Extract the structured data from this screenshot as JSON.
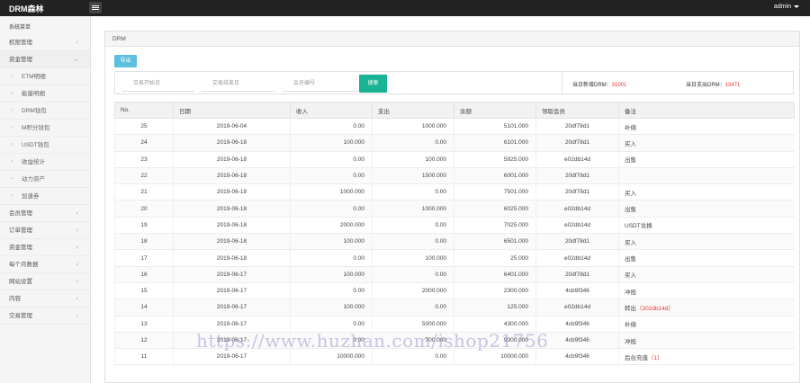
{
  "topbar": {
    "brand": "DRM森林",
    "user": "admin"
  },
  "sidebar": {
    "heading": "系统菜单",
    "items": [
      {
        "label": "权限管理",
        "chevron": "‹",
        "sub": false
      },
      {
        "label": "资金管理",
        "chevron": "⌄",
        "sub": false,
        "open": true
      },
      {
        "label": "ETM明细",
        "sub": true
      },
      {
        "label": "能量明细",
        "sub": true
      },
      {
        "label": "DRM钱包",
        "sub": true
      },
      {
        "label": "M积分钱包",
        "sub": true
      },
      {
        "label": "USDT钱包",
        "sub": true
      },
      {
        "label": "收益统计",
        "sub": true
      },
      {
        "label": "动力资产",
        "sub": true
      },
      {
        "label": "加速券",
        "sub": true
      },
      {
        "label": "会员管理",
        "chevron": "‹",
        "sub": false
      },
      {
        "label": "订单管理",
        "chevron": "‹",
        "sub": false
      },
      {
        "label": "资金管理",
        "chevron": "‹",
        "sub": false
      },
      {
        "label": "每个月数据",
        "chevron": "‹",
        "sub": false
      },
      {
        "label": "网站设置",
        "chevron": "‹",
        "sub": false
      },
      {
        "label": "内容",
        "chevron": "‹",
        "sub": false
      },
      {
        "label": "交易管理",
        "chevron": "‹",
        "sub": false
      }
    ]
  },
  "panel": {
    "title": "DRM",
    "export_label": "导出"
  },
  "filters": {
    "start_placeholder": "交易开始日",
    "end_placeholder": "交易结束日",
    "member_placeholder": "会员编号",
    "search_label": "搜索"
  },
  "stats": {
    "new_label": "当日新增DRM：",
    "new_value": "31001",
    "out_label": "当日支出DRM：",
    "out_value": "13471"
  },
  "table": {
    "headers": [
      "No.",
      "日期",
      "收入",
      "支出",
      "余额",
      "领取会员",
      "备注"
    ],
    "rows": [
      {
        "no": "25",
        "date": "2019-06-04",
        "income": "0.00",
        "expense": "1000.000",
        "balance": "5101.000",
        "member": "20df78d1",
        "note": "补偿",
        "note_extra": ""
      },
      {
        "no": "24",
        "date": "2019-06-18",
        "income": "100.000",
        "expense": "0.00",
        "balance": "6101.000",
        "member": "20df78d1",
        "note": "买入",
        "note_extra": ""
      },
      {
        "no": "23",
        "date": "2019-06-18",
        "income": "0.00",
        "expense": "100.000",
        "balance": "5925.000",
        "member": "e02db14d",
        "note": "出售",
        "note_extra": ""
      },
      {
        "no": "22",
        "date": "2019-06-18",
        "income": "0.00",
        "expense": "1500.000",
        "balance": "6001.000",
        "member": "20df78d1",
        "note": "",
        "note_extra": ""
      },
      {
        "no": "21",
        "date": "2019-06-18",
        "income": "1000.000",
        "expense": "0.00",
        "balance": "7501.000",
        "member": "20df78d1",
        "note": "买入",
        "note_extra": ""
      },
      {
        "no": "20",
        "date": "2019-06-18",
        "income": "0.00",
        "expense": "1000.000",
        "balance": "6025.000",
        "member": "e02db14d",
        "note": "出售",
        "note_extra": ""
      },
      {
        "no": "19",
        "date": "2019-06-18",
        "income": "2000.000",
        "expense": "0.00",
        "balance": "7025.000",
        "member": "e02db14d",
        "note": "USDT兑换",
        "note_extra": ""
      },
      {
        "no": "18",
        "date": "2019-06-18",
        "income": "100.000",
        "expense": "0.00",
        "balance": "6501.000",
        "member": "20df78d1",
        "note": "买入",
        "note_extra": ""
      },
      {
        "no": "17",
        "date": "2019-06-18",
        "income": "0.00",
        "expense": "100.000",
        "balance": "25.000",
        "member": "e02db14d",
        "note": "出售",
        "note_extra": ""
      },
      {
        "no": "16",
        "date": "2019-06-17",
        "income": "100.000",
        "expense": "0.00",
        "balance": "6401.000",
        "member": "20df78d1",
        "note": "买入",
        "note_extra": ""
      },
      {
        "no": "15",
        "date": "2019-06-17",
        "income": "0.00",
        "expense": "2000.000",
        "balance": "2300.000",
        "member": "4cb9f346",
        "note": "冲抵",
        "note_extra": ""
      },
      {
        "no": "14",
        "date": "2019-06-17",
        "income": "100.000",
        "expense": "0.00",
        "balance": "125.000",
        "member": "e02db14d",
        "note": "转出",
        "note_extra": "（202db14d）"
      },
      {
        "no": "13",
        "date": "2019-06-17",
        "income": "0.00",
        "expense": "5000.000",
        "balance": "4300.000",
        "member": "4cb9f346",
        "note": "补偿",
        "note_extra": ""
      },
      {
        "no": "12",
        "date": "2019-06-17",
        "income": "0.00",
        "expense": "700.000",
        "balance": "9300.000",
        "member": "4cb9f346",
        "note": "冲抵",
        "note_extra": ""
      },
      {
        "no": "11",
        "date": "2019-06-17",
        "income": "10000.000",
        "expense": "0.00",
        "balance": "10000.000",
        "member": "4cb9f346",
        "note": "后台充值",
        "note_extra": "（1）"
      }
    ]
  },
  "watermark": "https://www.huzhan.com/ishop21756",
  "colors": {
    "topbar": "#222222",
    "export": "#5bc0de",
    "search": "#1ab394",
    "stat_value": "#ee3333"
  }
}
